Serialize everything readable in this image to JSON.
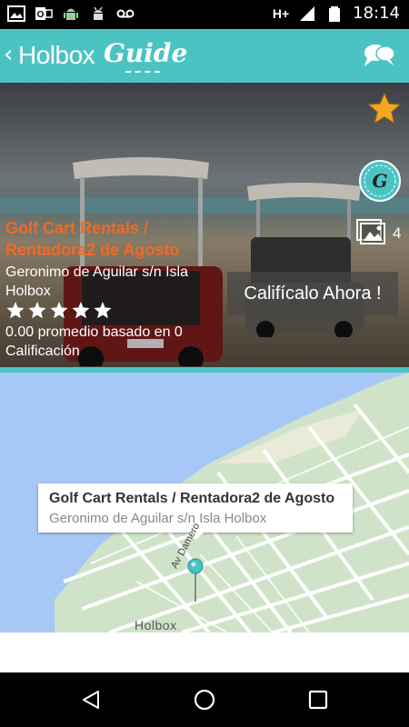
{
  "status_bar": {
    "time": "18:14",
    "network": "H+",
    "icons": [
      "image-icon",
      "outlook-icon",
      "android-robot-icon",
      "android-debug-icon",
      "voicemail-icon",
      "signal-icon",
      "battery-icon"
    ]
  },
  "app_bar": {
    "brand": "Holbox",
    "brand_script": "Guide",
    "colors": {
      "bar": "#4cc3c3"
    }
  },
  "place": {
    "title": "Golf Cart Rentals / Rentadora2 de Agosto",
    "address": "Geronimo de Aguilar s/n Isla Holbox",
    "rating_value": 0,
    "rating_max": 5,
    "rating_text": "0.00 promedio basado en 0 Calificación",
    "photo_count": "4",
    "rate_button": "Califícalo Ahora !",
    "colors": {
      "title": "#f06a23",
      "favorite": "#f5a623"
    }
  },
  "map": {
    "info_title": "Golf Cart Rentals / Rentadora2 de Agosto",
    "info_subtitle": "Geronimo de Aguilar s/n Isla Holbox",
    "street_label": "Av Damero",
    "town_label": "Holbox",
    "colors": {
      "water": "#a7c8f6",
      "land": "#cfe3c9",
      "pin": "#48c3c3"
    }
  },
  "nav_bar": {
    "icons": [
      "back-icon",
      "home-icon",
      "recent-apps-icon"
    ]
  }
}
